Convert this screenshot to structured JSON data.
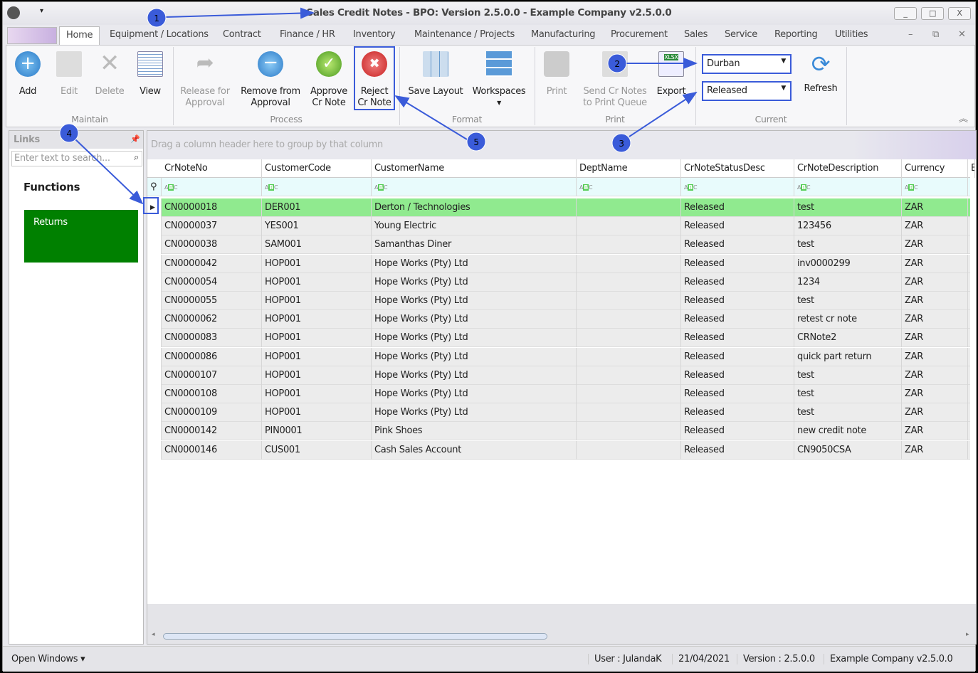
{
  "window": {
    "title": "Sales Credit Notes - BPO: Version 2.5.0.0 - Example Company v2.5.0.0",
    "min": "_",
    "max": "□",
    "close": "X"
  },
  "tabs": [
    "Home",
    "Equipment / Locations",
    "Contract",
    "Finance / HR",
    "Inventory",
    "Maintenance / Projects",
    "Manufacturing",
    "Procurement",
    "Sales",
    "Service",
    "Reporting",
    "Utilities"
  ],
  "ribbon": {
    "buttons": {
      "add": "Add",
      "edit": "Edit",
      "delete": "Delete",
      "view": "View",
      "release1": "Release for",
      "release2": "Approval",
      "remove1": "Remove from",
      "remove2": "Approval",
      "approve1": "Approve",
      "approve2": "Cr Note",
      "reject1": "Reject",
      "reject2": "Cr Note",
      "save_layout": "Save Layout",
      "workspaces": "Workspaces",
      "print": "Print",
      "send1": "Send Cr Notes",
      "send2": "to Print Queue",
      "export": "Export",
      "refresh": "Refresh"
    },
    "groups": {
      "maintain": "Maintain",
      "process": "Process",
      "format": "Format",
      "print": "Print",
      "current": "Current"
    },
    "site": "Durban",
    "status": "Released"
  },
  "links": {
    "title": "Links",
    "search_placeholder": "Enter text to search...",
    "functions": "Functions",
    "returns": "Returns"
  },
  "grid": {
    "group_hint": "Drag a column header here to group by that column",
    "columns": [
      "CrNoteNo",
      "CustomerCode",
      "CustomerName",
      "DeptName",
      "CrNoteStatusDesc",
      "CrNoteDescription",
      "Currency",
      "E"
    ],
    "rows": [
      [
        "CN0000018",
        "DER001",
        "Derton / Technologies",
        "",
        "Released",
        "test",
        "ZAR"
      ],
      [
        "CN0000037",
        "YES001",
        "Young Electric",
        "",
        "Released",
        "123456",
        "ZAR"
      ],
      [
        "CN0000038",
        "SAM001",
        "Samanthas Diner",
        "",
        "Released",
        "test",
        "ZAR"
      ],
      [
        "CN0000042",
        "HOP001",
        "Hope Works (Pty) Ltd",
        "",
        "Released",
        "inv0000299",
        "ZAR"
      ],
      [
        "CN0000054",
        "HOP001",
        "Hope Works (Pty) Ltd",
        "",
        "Released",
        "1234",
        "ZAR"
      ],
      [
        "CN0000055",
        "HOP001",
        "Hope Works (Pty) Ltd",
        "",
        "Released",
        "test",
        "ZAR"
      ],
      [
        "CN0000062",
        "HOP001",
        "Hope Works (Pty) Ltd",
        "",
        "Released",
        "retest cr note",
        "ZAR"
      ],
      [
        "CN0000083",
        "HOP001",
        "Hope Works (Pty) Ltd",
        "",
        "Released",
        "CRNote2",
        "ZAR"
      ],
      [
        "CN0000086",
        "HOP001",
        "Hope Works (Pty) Ltd",
        "",
        "Released",
        "quick part return",
        "ZAR"
      ],
      [
        "CN0000107",
        "HOP001",
        "Hope Works (Pty) Ltd",
        "",
        "Released",
        "test",
        "ZAR"
      ],
      [
        "CN0000108",
        "HOP001",
        "Hope Works (Pty) Ltd",
        "",
        "Released",
        "test",
        "ZAR"
      ],
      [
        "CN0000109",
        "HOP001",
        "Hope Works (Pty) Ltd",
        "",
        "Released",
        "test",
        "ZAR"
      ],
      [
        "CN0000142",
        "PIN0001",
        "Pink Shoes",
        "",
        "Released",
        "new credit note",
        "ZAR"
      ],
      [
        "CN0000146",
        "CUS001",
        "Cash Sales Account",
        "",
        "Released",
        "CN9050CSA",
        "ZAR"
      ]
    ]
  },
  "statusbar": {
    "open_windows": "Open Windows ▾",
    "user": "User : JulandaK",
    "date": "21/04/2021",
    "version": "Version : 2.5.0.0",
    "company": "Example Company v2.5.0.0"
  },
  "annotations": [
    "1",
    "2",
    "3",
    "4",
    "5"
  ],
  "colors": {
    "selected_row": "#90ea8f",
    "returns": "#008000",
    "annotation": "#3a5bd9"
  }
}
